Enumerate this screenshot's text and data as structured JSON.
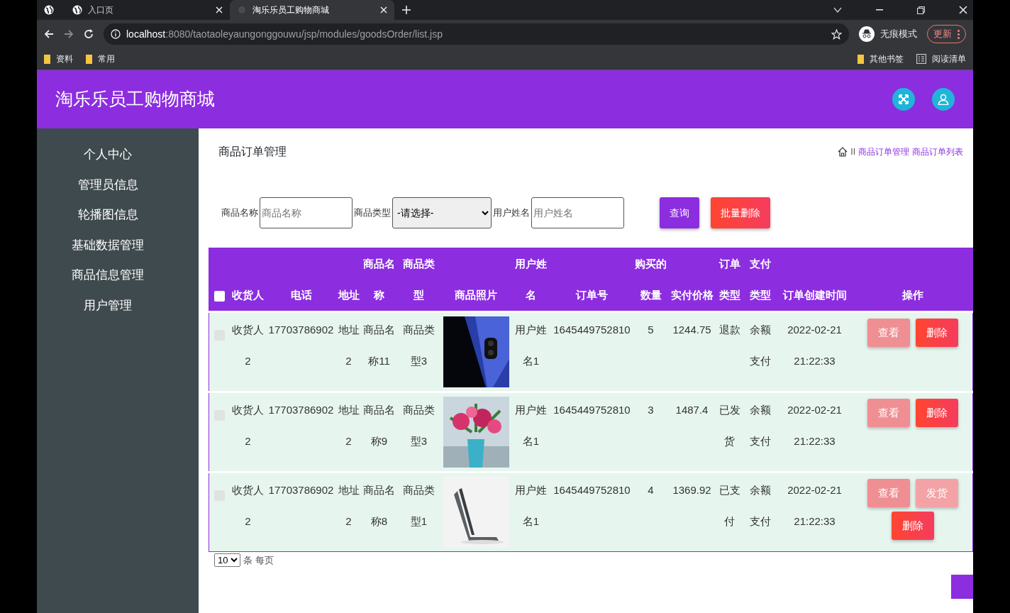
{
  "browser": {
    "tabs": [
      {
        "kind": "pinned",
        "selected": false
      },
      {
        "kind": "normal",
        "title": "入口页",
        "selected": false
      },
      {
        "kind": "normal",
        "title": "淘乐乐员工购物商城",
        "selected": true
      }
    ],
    "url_host": "localhost",
    "url_path": ":8080/taotaoleyaungonggouwu/jsp/modules/goodsOrder/list.jsp",
    "incognito_label": "无痕模式",
    "update_label": "更新",
    "bookmarks_left": [
      "资料",
      "常用"
    ],
    "bookmarks_right": [
      {
        "kind": "folder",
        "label": "其他书签"
      },
      {
        "kind": "list",
        "label": "阅读清单"
      }
    ]
  },
  "app": {
    "title": "淘乐乐员工购物商城",
    "sidebar": {
      "items": [
        "个人中心",
        "管理员信息",
        "轮播图信息",
        "基础数据管理",
        "商品信息管理",
        "用户管理"
      ]
    },
    "page_title": "商品订单管理",
    "breadcrumb": [
      {
        "kind": "home"
      },
      {
        "kind": "sep",
        "label": "II"
      },
      {
        "kind": "link",
        "label": "商品订单管理"
      },
      {
        "kind": "link",
        "label": "商品订单列表"
      }
    ],
    "search": [
      {
        "label": "商品名称",
        "kind": "input",
        "placeholder": "商品名称"
      },
      {
        "label": "商品类型",
        "kind": "select",
        "value": "-请选择-"
      },
      {
        "label": "用户姓名",
        "kind": "input",
        "placeholder": "用户姓名"
      }
    ],
    "buttons": [
      {
        "label": "查询",
        "kind": "query"
      },
      {
        "label": "批量删除",
        "kind": "danger"
      }
    ],
    "table": {
      "select_all_checked": false,
      "columns": [
        "收货人",
        "电话",
        "地址",
        "商品名称",
        "商品类型",
        "商品照片",
        "用户姓名",
        "订单号",
        "购买的数量",
        "实付价格",
        "订单类型",
        "支付类型",
        "订单创建时间",
        "操作"
      ],
      "rows": [
        {
          "checked": false,
          "cells": [
            "收货人2",
            "17703786902",
            "地址2",
            "商品名称11",
            "商品类型3",
            {
              "kind": "picture"
            },
            "用户姓名1",
            "1645449752810",
            "5",
            "1244.75",
            "退款",
            "余额支付",
            "2022-02-21 21:22:33"
          ],
          "actions": [
            {
              "label": "查看",
              "kind": "view"
            },
            {
              "label": "删除",
              "kind": "delete"
            }
          ]
        },
        {
          "checked": false,
          "cells": [
            "收货人2",
            "17703786902",
            "地址2",
            "商品名称9",
            "商品类型3",
            {
              "kind": "picture"
            },
            "用户姓名1",
            "1645449752810",
            "3",
            "1487.4",
            "已发货",
            "余额支付",
            "2022-02-21 21:22:33"
          ],
          "actions": [
            {
              "label": "查看",
              "kind": "view"
            },
            {
              "label": "删除",
              "kind": "delete"
            }
          ]
        },
        {
          "checked": false,
          "cells": [
            "收货人2",
            "17703786902",
            "地址2",
            "商品名称8",
            "商品类型1",
            {
              "kind": "picture"
            },
            "用户姓名1",
            "1645449752810",
            "4",
            "1369.92",
            "已支付",
            "余额支付",
            "2022-02-21 21:22:33"
          ],
          "actions": [
            {
              "label": "查看",
              "kind": "view"
            },
            {
              "label": "发货",
              "kind": "ship"
            },
            {
              "label": "删除",
              "kind": "delete"
            }
          ]
        }
      ]
    },
    "pagination": {
      "page_size": "10",
      "label": "条 每页"
    }
  }
}
